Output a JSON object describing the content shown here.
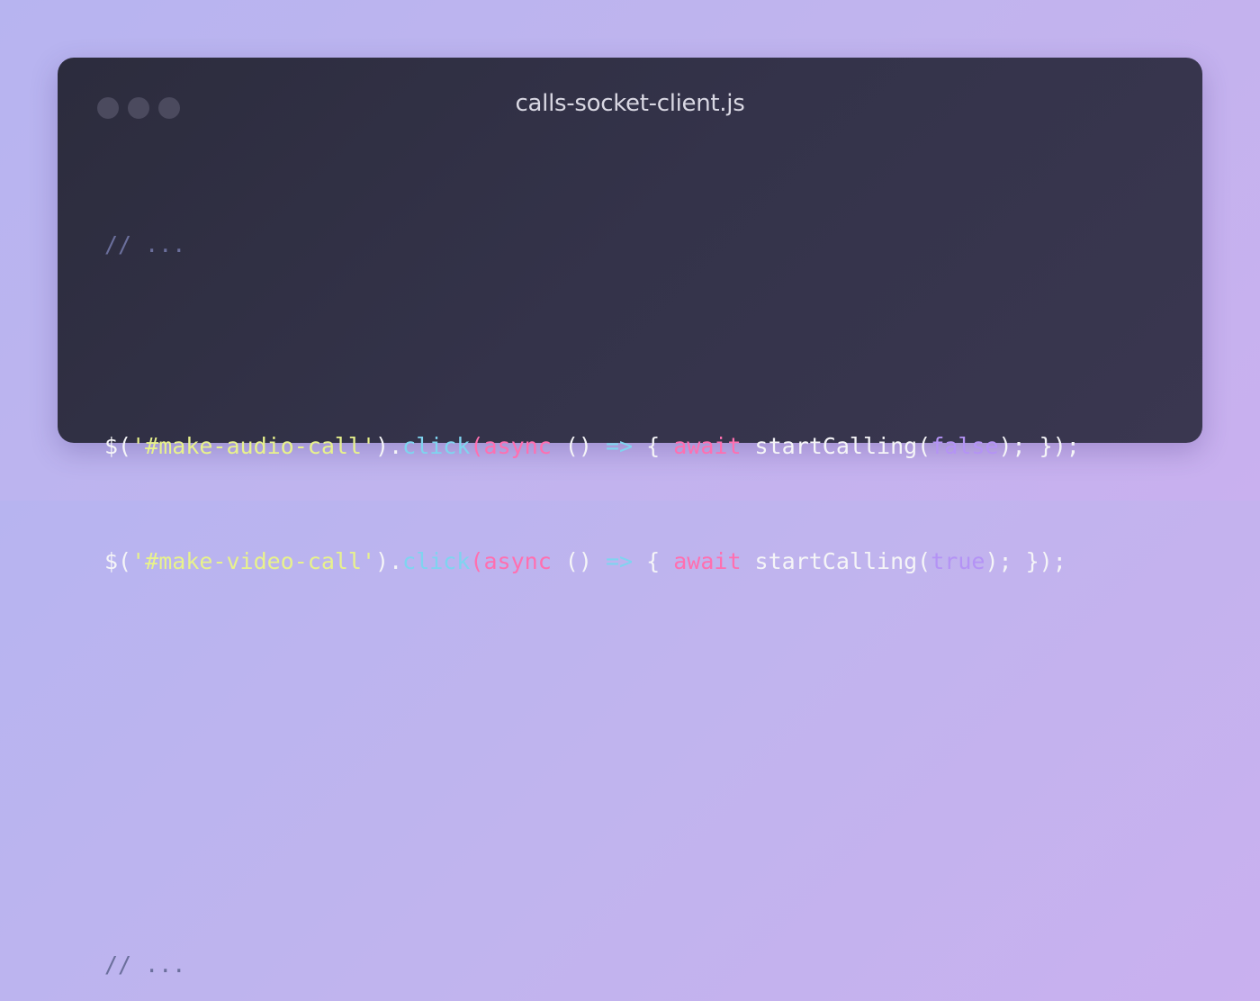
{
  "window": {
    "title": "calls-socket-client.js",
    "traffic_lights": [
      "close-dot",
      "minimize-dot",
      "maximize-dot"
    ]
  },
  "code": {
    "comment_top": "// ...",
    "comment_bottom": "// ...",
    "lines": [
      {
        "dollar": "$(",
        "selector": "'#make-audio-call'",
        "close_paren_dot": ").",
        "method": "click",
        "open_paren": "(",
        "async_kw": "async",
        "params": " () ",
        "arrow": "=>",
        "open_brace": " { ",
        "await_kw": "await",
        "call_name": " startCalling(",
        "arg": "false",
        "tail": "); });"
      },
      {
        "dollar": "$(",
        "selector": "'#make-video-call'",
        "close_paren_dot": ").",
        "method": "click",
        "open_paren": "(",
        "async_kw": "async",
        "params": " () ",
        "arrow": "=>",
        "open_brace": " { ",
        "await_kw": "await",
        "call_name": " startCalling(",
        "arg": "true",
        "tail": "); });"
      }
    ]
  },
  "colors": {
    "background": "#bdb4ef",
    "window": "#312f44",
    "comment": "#6b6f9c",
    "string": "#e8f28c",
    "method": "#7fd4ef",
    "keyword": "#ff6fb0",
    "boolean": "#b493f5",
    "text": "#f5f5f7"
  }
}
